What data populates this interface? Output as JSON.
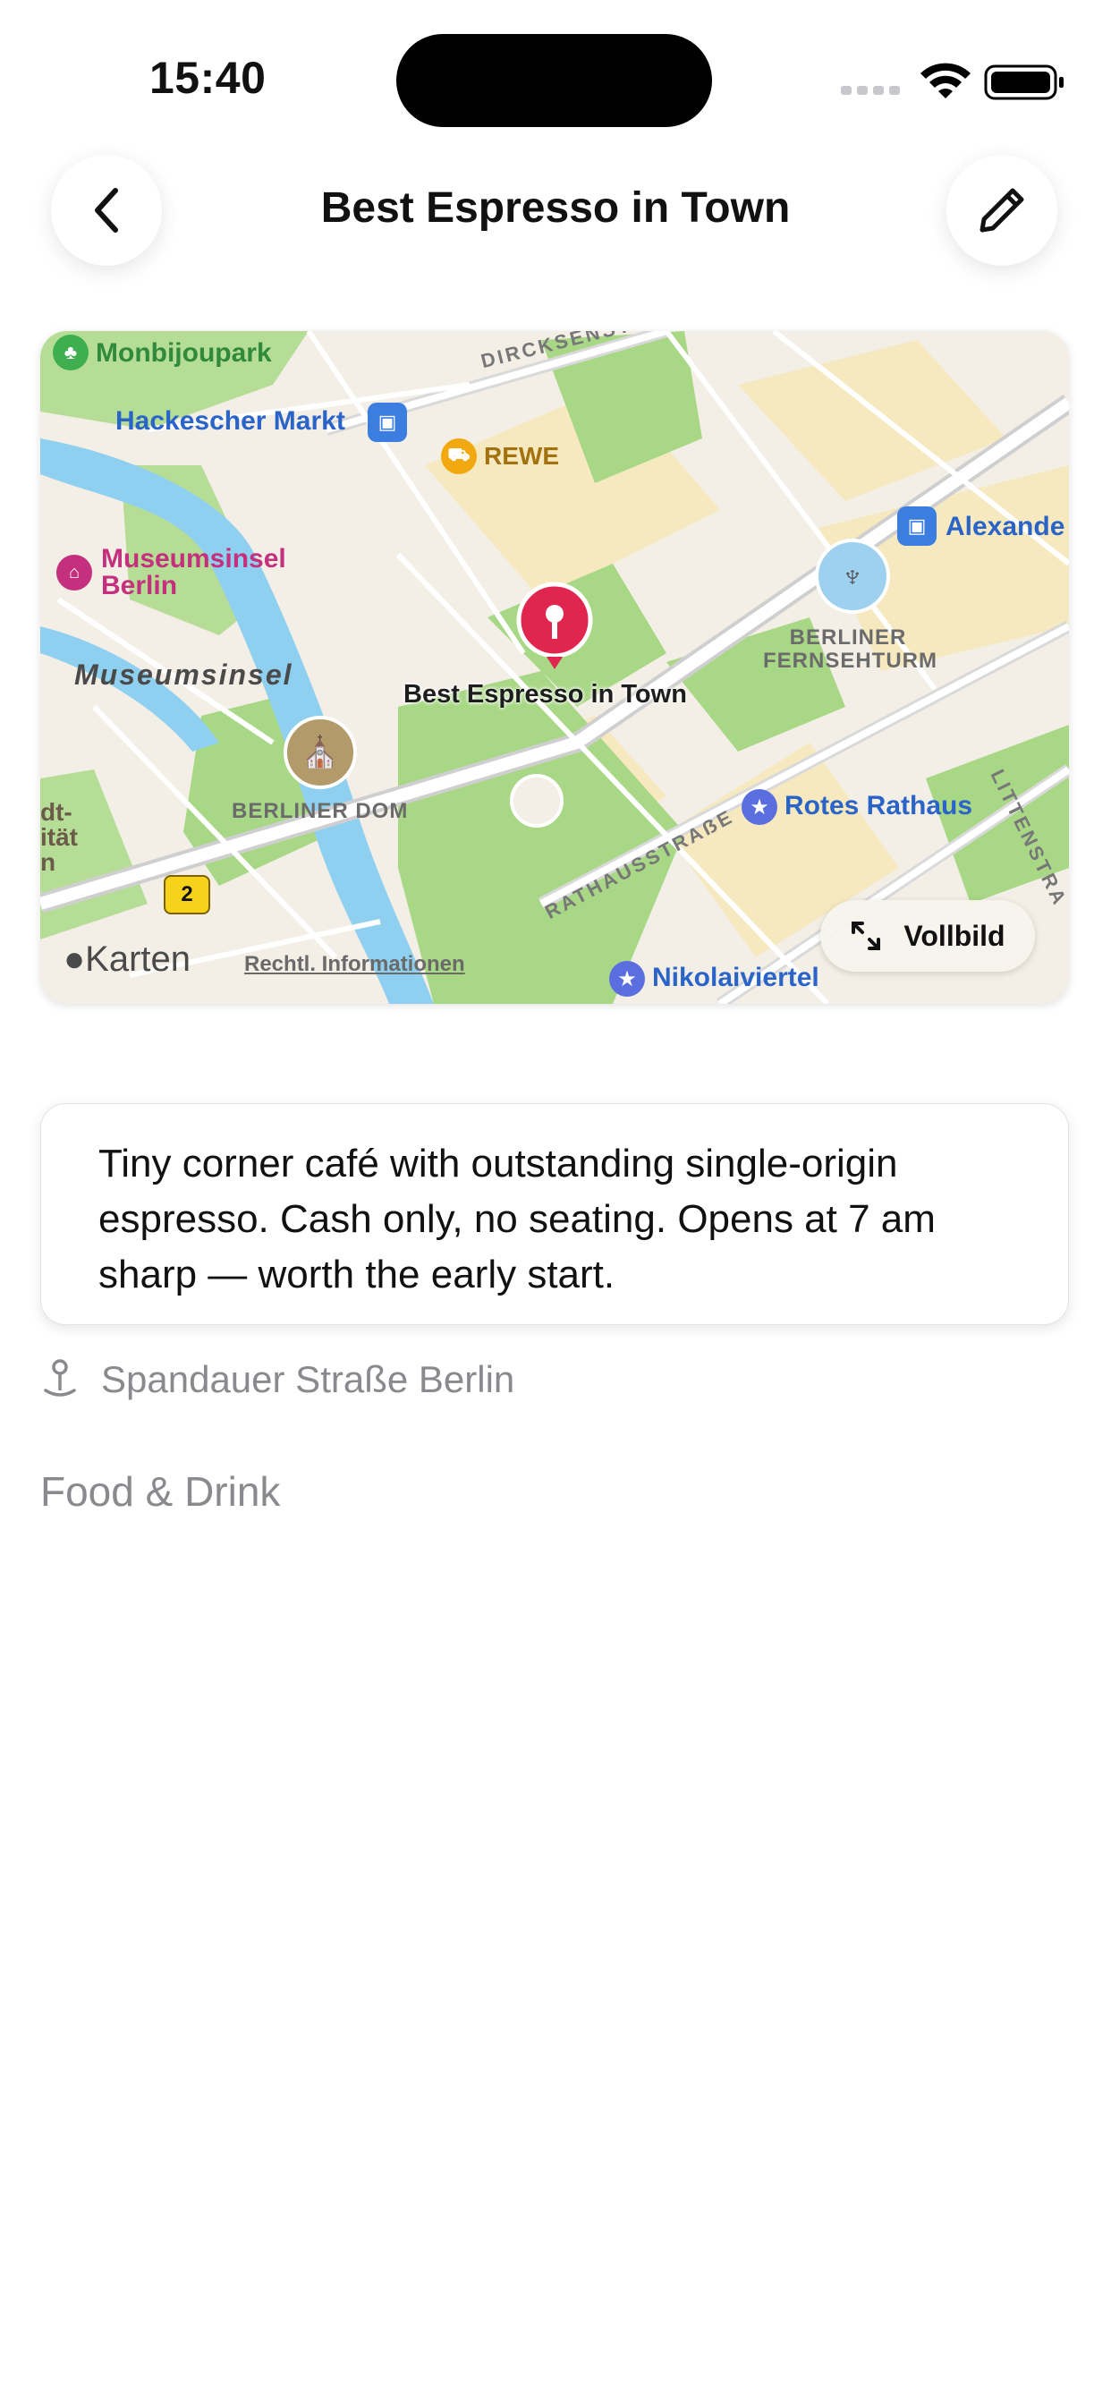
{
  "status_bar": {
    "time": "15:40"
  },
  "nav": {
    "title": "Best Espresso in Town",
    "back_icon": "chevron-left-icon",
    "edit_icon": "pencil-icon"
  },
  "map": {
    "labels": {
      "monbijoupark": "Monbijoupark",
      "hackescher_markt": "Hackescher Markt",
      "rewe": "REWE",
      "dircksenstrasse": "DIRCKSENSTRAẞE",
      "alexanderplatz": "Alexande",
      "museumsinsel_poi_line1": "Museumsinsel",
      "museumsinsel_poi_line2": "Berlin",
      "museumsinsel_area": "Museumsinsel",
      "fernsehturm_line1": "BERLINER",
      "fernsehturm_line2": "FERNSEHTURM",
      "pin": "Best Espresso in Town",
      "berliner_dom": "BERLINER DOM",
      "rotes_rathaus": "Rotes Rathaus",
      "rathausstrasse": "RATHAUSSTRAẞE",
      "littenstrasse": "LITTENSTRA",
      "edge_line1": "dt-",
      "edge_line2": "ität",
      "edge_line3": "n",
      "route_number": "2",
      "nikolaiviertel": "Nikolaiviertel"
    },
    "brand": "Karten",
    "legal": "Rechtl. Informationen",
    "fullscreen_label": "Vollbild",
    "pin_color": "#e0264f"
  },
  "note": "Tiny corner café with outstanding single-origin espresso. Cash only, no seating. Opens at 7 am sharp — worth the early start.",
  "address": {
    "icon": "map-pin-icon",
    "text": "Spandauer Straße Berlin"
  },
  "category": "Food & Drink"
}
